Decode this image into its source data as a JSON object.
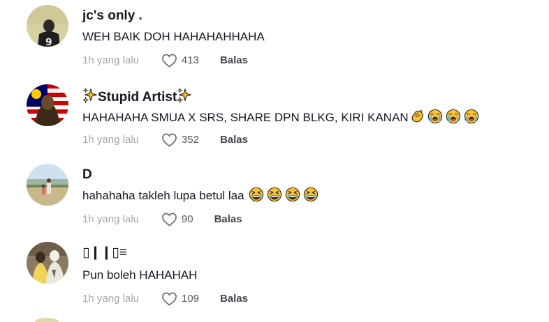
{
  "comments": [
    {
      "username": "jc's only .",
      "text": "WEH BAIK DOH HAHAHAHHAHA",
      "time": "1h yang lalu",
      "likes": "413",
      "reply_label": "Balas",
      "avatar": "jersey-number-9-avatar",
      "emojis": []
    },
    {
      "username": "Stupid Artist",
      "username_icons": [
        "sparkles-icon",
        "sparkles-icon"
      ],
      "text": "HAHAHAHA SMUA X SRS, SHARE DPN BLKG, KIRI KANAN",
      "time": "1h yang lalu",
      "likes": "352",
      "reply_label": "Balas",
      "avatar": "flag-portrait-avatar",
      "emojis": [
        "clapping-hands-emoji",
        "loudly-crying-face-emoji",
        "loudly-crying-face-emoji",
        "loudly-crying-face-emoji"
      ]
    },
    {
      "username": "D",
      "text": "hahahaha takleh lupa betul laa",
      "time": "1h yang lalu",
      "likes": "90",
      "reply_label": "Balas",
      "avatar": "outdoor-family-avatar",
      "emojis": [
        "grinning-squinting-face-emoji",
        "grinning-squinting-face-emoji",
        "grinning-squinting-face-emoji",
        "grinning-squinting-face-emoji"
      ]
    },
    {
      "username": "▯❙❙▯≡",
      "text": "Pun boleh HAHAHAH",
      "time": "1h yang lalu",
      "likes": "109",
      "reply_label": "Balas",
      "avatar": "couple-photo-avatar",
      "emojis": []
    }
  ],
  "colors": {
    "background": "#ffffff",
    "text_primary": "#161823",
    "text_secondary": "#8a8b91"
  }
}
